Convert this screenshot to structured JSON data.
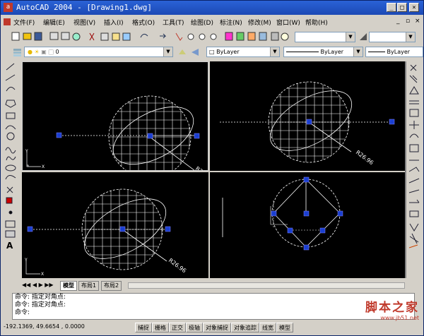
{
  "window": {
    "title": "AutoCAD 2004 - [Drawing1.dwg]",
    "app_icon": "a"
  },
  "menu": [
    "文件(F)",
    "编辑(E)",
    "视图(V)",
    "插入(I)",
    "格式(O)",
    "工具(T)",
    "绘图(D)",
    "标注(N)",
    "修改(M)",
    "窗口(W)",
    "帮助(H)"
  ],
  "layer": {
    "name": "0"
  },
  "properties": {
    "color": "ByLayer",
    "linetype": "ByLayer",
    "lineweight": "ByLayer"
  },
  "tabs": [
    "模型",
    "布局1",
    "布局2"
  ],
  "command": {
    "line1": "命令:  指定对角点:",
    "line2": "命令:  指定对角点:",
    "line3": "命令:"
  },
  "status": {
    "coords": "-192.1369, 49.6654 , 0.0000",
    "buttons": [
      "捕捉",
      "栅格",
      "正交",
      "极轴",
      "对象捕捉",
      "对象追踪",
      "线宽",
      "模型"
    ]
  },
  "drawing": {
    "dimension_label": "R26.96",
    "dimension_label_cut": "R2"
  },
  "watermark": {
    "text": "脚本之家",
    "url": "www.jb51.net"
  },
  "colors": {
    "title_bar": "#1c49b5",
    "viewport_bg": "#000000",
    "grip": "#1a3fd1",
    "geometry": "#ffffff",
    "watermark": "#c0392b"
  }
}
